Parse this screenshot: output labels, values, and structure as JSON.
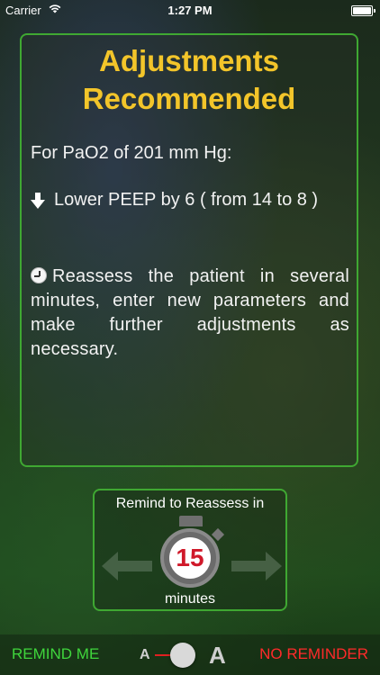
{
  "status_bar": {
    "carrier": "Carrier",
    "time": "1:27 PM"
  },
  "panel": {
    "title_line1": "Adjustments",
    "title_line2": "Recommended",
    "pao2_text": "For PaO2 of 201 mm Hg:",
    "peep_text": "Lower PEEP by 6 ( from 14 to 8 )",
    "reassess_text": "Reassess the patient in several minutes, enter new parameters and make further adjustments as necessary."
  },
  "reminder": {
    "title": "Remind to Reassess in",
    "value": "15",
    "unit": "minutes"
  },
  "bottom_bar": {
    "remind_me": "REMIND ME",
    "font_small": "A",
    "font_large": "A",
    "no_reminder": "NO REMINDER"
  },
  "colors": {
    "accent_green": "#3fa832",
    "title_yellow": "#f3c52a",
    "remind_green": "#3fd63c",
    "no_reminder_red": "#ff2a2a",
    "timer_red": "#d0192a"
  },
  "icons": [
    "wifi-icon",
    "battery-icon",
    "arrow-down-icon",
    "clock-icon",
    "stopwatch-icon",
    "arrow-left-icon",
    "arrow-right-icon"
  ]
}
